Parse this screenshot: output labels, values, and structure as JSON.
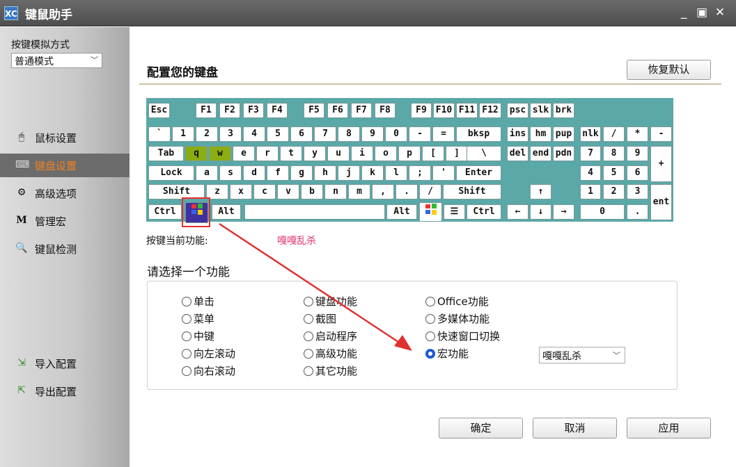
{
  "window": {
    "title": "键鼠助手",
    "icon": "XC"
  },
  "sidebar": {
    "mode_label": "按键模拟方式",
    "mode_value": "普通模式",
    "items": [
      {
        "label": "鼠标设置",
        "icon": "mouse-icon"
      },
      {
        "label": "键盘设置",
        "icon": "keyboard-icon",
        "active": true
      },
      {
        "label": "高级选项",
        "icon": "gear-icon"
      },
      {
        "label": "管理宏",
        "icon": "macro-m-icon"
      },
      {
        "label": "键鼠检测",
        "icon": "magnifier-icon"
      },
      {
        "label": "导入配置",
        "icon": "import-icon"
      },
      {
        "label": "导出配置",
        "icon": "export-icon"
      }
    ]
  },
  "main": {
    "title": "配置您的键盘",
    "restore_button": "恢复默认",
    "current_label": "按键当前功能:",
    "current_value": "嘎嘎乱杀",
    "choose_title": "请选择一个功能",
    "options": [
      "单击",
      "菜单",
      "中键",
      "向左滚动",
      "向右滚动",
      "键盘功能",
      "截图",
      "启动程序",
      "高级功能",
      "其它功能",
      "Office功能",
      "多媒体功能",
      "快速窗口切换",
      "宏功能"
    ],
    "selected_option": "宏功能",
    "macro_value": "嘎嘎乱杀",
    "ok_button": "确定",
    "cancel_button": "取消",
    "apply_button": "应用"
  },
  "keyboard": {
    "keys": [
      "Esc",
      "F1",
      "F2",
      "F3",
      "F4",
      "F5",
      "F6",
      "F7",
      "F8",
      "F9",
      "F10",
      "F11",
      "F12",
      "psc",
      "slk",
      "brk",
      "`",
      "1",
      "2",
      "3",
      "4",
      "5",
      "6",
      "7",
      "8",
      "9",
      "0",
      "-",
      "=",
      "bksp",
      "ins",
      "hm",
      "pup",
      "nlk",
      "/",
      "*",
      "-",
      "Tab",
      "q",
      "w",
      "e",
      "r",
      "t",
      "y",
      "u",
      "i",
      "o",
      "p",
      "[",
      "]",
      "\\",
      "del",
      "end",
      "pdn",
      "7",
      "8",
      "9",
      "+",
      "Lock",
      "a",
      "s",
      "d",
      "f",
      "g",
      "h",
      "j",
      "k",
      "l",
      ";",
      "'",
      "Enter",
      "4",
      "5",
      "6",
      "Shift",
      "z",
      "x",
      "c",
      "v",
      "b",
      "n",
      "m",
      ",",
      ".",
      "/",
      "Shift",
      "↑",
      "1",
      "2",
      "3",
      "ent",
      "Ctrl",
      "Alt",
      "Alt",
      "Ctrl",
      "←",
      "↓",
      "→",
      "0",
      "."
    ],
    "highlighted": [
      "q",
      "w"
    ]
  },
  "colors": {
    "accent": "#1a5ad8",
    "keyboard_bg": "#5aa8a8",
    "highlight": "#8bad12",
    "active_nav": "#f08020",
    "annotation": "#e03030"
  }
}
